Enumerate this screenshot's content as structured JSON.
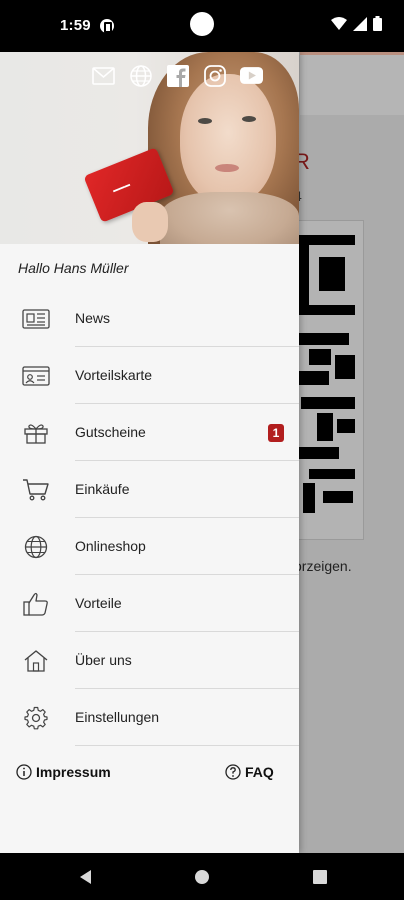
{
  "status_bar": {
    "time": "1:59"
  },
  "background_screen": {
    "title_fragment": "R",
    "subtitle_fragment": "4",
    "hint_fragment": "orzeigen."
  },
  "drawer": {
    "greeting": "Hallo Hans Müller",
    "social_icons": [
      "mail-icon",
      "globe-icon",
      "facebook-icon",
      "instagram-icon",
      "youtube-icon"
    ],
    "menu_items": [
      {
        "label": "News",
        "icon": "newspaper-icon"
      },
      {
        "label": "Vorteilskarte",
        "icon": "member-card-icon"
      },
      {
        "label": "Gutscheine",
        "icon": "gift-icon",
        "badge": "1"
      },
      {
        "label": "Einkäufe",
        "icon": "cart-icon"
      },
      {
        "label": "Onlineshop",
        "icon": "globe-icon"
      },
      {
        "label": "Vorteile",
        "icon": "thumbs-up-icon"
      },
      {
        "label": "Über uns",
        "icon": "home-icon"
      },
      {
        "label": "Einstellungen",
        "icon": "gear-icon"
      }
    ],
    "footer": {
      "impressum": "Impressum",
      "faq": "FAQ"
    }
  },
  "colors": {
    "accent": "#b21e1e",
    "drawer_bg": "#f6f6f6",
    "scrim": "#ababab"
  }
}
